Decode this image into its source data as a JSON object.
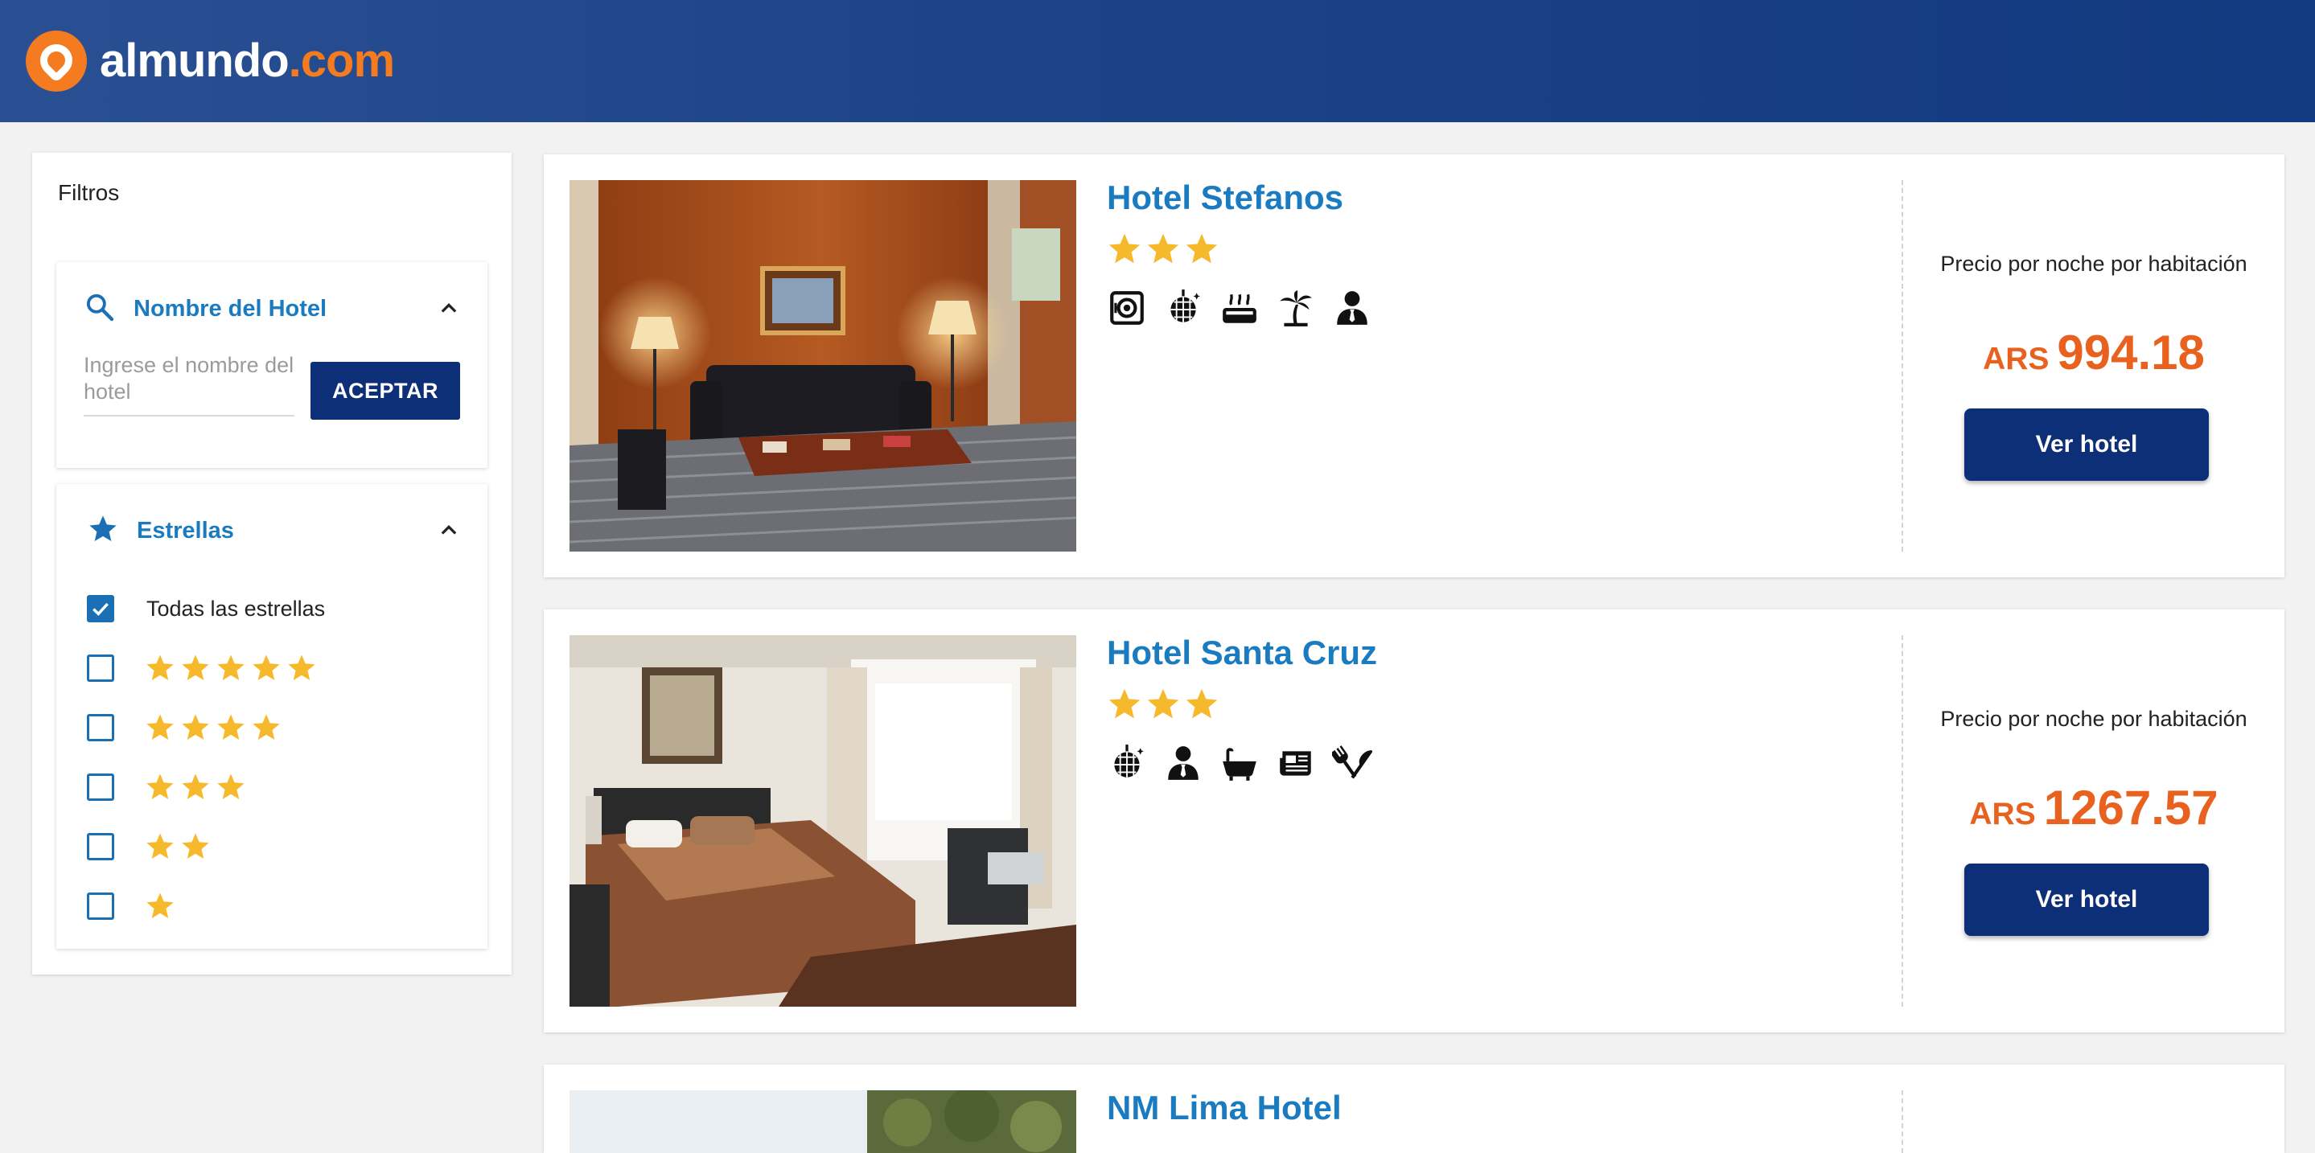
{
  "header": {
    "logo_word": "almundo",
    "logo_tld": ".com",
    "logo_icon": "pin-icon"
  },
  "colors": {
    "header_blue": "#1d4387",
    "accent_orange": "#f47b20",
    "title_blue": "#1a7bc0",
    "button_navy": "#0d2f77",
    "price_orange": "#e8611e",
    "star_yellow": "#f6b92b"
  },
  "filters": {
    "title": "Filtros",
    "hotel_name": {
      "title": "Nombre del Hotel",
      "icon": "search-icon",
      "placeholder": "Ingrese el nombre del hotel",
      "value": "",
      "button": "ACEPTAR"
    },
    "stars": {
      "title": "Estrellas",
      "icon": "star-icon",
      "all_label": "Todas las estrellas",
      "all_checked": true,
      "options": [
        {
          "stars": 5,
          "checked": false
        },
        {
          "stars": 4,
          "checked": false
        },
        {
          "stars": 3,
          "checked": false
        },
        {
          "stars": 2,
          "checked": false
        },
        {
          "stars": 1,
          "checked": false
        }
      ]
    }
  },
  "results": [
    {
      "name": "Hotel Stefanos",
      "stars": 3,
      "amenities": [
        "safe-box-icon",
        "disco-ball-icon",
        "hot-tub-icon",
        "palm-tree-icon",
        "concierge-icon"
      ],
      "price_label": "Precio por noche por habitación",
      "currency": "ARS",
      "price": "994.18",
      "button": "Ver hotel"
    },
    {
      "name": "Hotel Santa Cruz",
      "stars": 3,
      "amenities": [
        "disco-ball-icon",
        "concierge-icon",
        "bathtub-icon",
        "newspaper-icon",
        "restaurant-icon"
      ],
      "price_label": "Precio por noche por habitación",
      "currency": "ARS",
      "price": "1267.57",
      "button": "Ver hotel"
    },
    {
      "name": "NM Lima Hotel"
    }
  ]
}
